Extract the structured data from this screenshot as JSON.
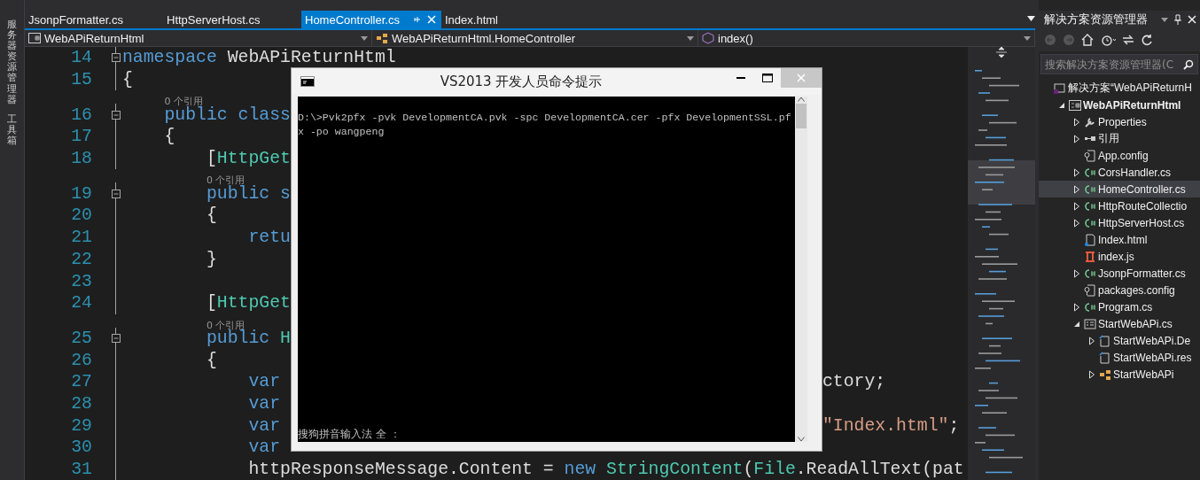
{
  "side_tabs": [
    {
      "label": "服务器资源管理器"
    },
    {
      "label": "工具箱"
    }
  ],
  "tabs": [
    {
      "label": "JsonpFormatter.cs",
      "selected": false
    },
    {
      "label": "HttpServerHost.cs",
      "selected": false
    },
    {
      "label": "HomeController.cs",
      "selected": true
    },
    {
      "label": "Index.html",
      "selected": false
    }
  ],
  "nav": [
    {
      "label": "WebAPiReturnHtml",
      "kind": "project"
    },
    {
      "label": "WebAPiReturnHtml.HomeController",
      "kind": "class"
    },
    {
      "label": "index()",
      "kind": "method"
    }
  ],
  "code_lines": [
    {
      "kind": "code",
      "number": "14",
      "fold": true,
      "tokens": [
        {
          "text": "namespace",
          "kind": "keyword"
        },
        {
          "text": " WebAPiReturnHtml",
          "kind": "plain"
        }
      ]
    },
    {
      "kind": "code",
      "number": "15",
      "fold": false,
      "tokens": [
        {
          "text": "{",
          "kind": "plain"
        }
      ]
    },
    {
      "kind": "codelens",
      "text": "    0 个引用"
    },
    {
      "kind": "code",
      "number": "16",
      "fold": true,
      "tokens": [
        {
          "text": "    public class",
          "kind": "keyword"
        }
      ]
    },
    {
      "kind": "code",
      "number": "17",
      "fold": false,
      "tokens": [
        {
          "text": "    {",
          "kind": "plain"
        }
      ]
    },
    {
      "kind": "code",
      "number": "18",
      "fold": false,
      "tokens": [
        {
          "text": "        [",
          "kind": "plain"
        },
        {
          "text": "HttpGet",
          "kind": "type"
        }
      ]
    },
    {
      "kind": "codelens",
      "text": "        0 个引用"
    },
    {
      "kind": "code",
      "number": "19",
      "fold": true,
      "tokens": [
        {
          "text": "        public s",
          "kind": "keyword"
        }
      ]
    },
    {
      "kind": "code",
      "number": "20",
      "fold": false,
      "tokens": [
        {
          "text": "        {",
          "kind": "plain"
        }
      ]
    },
    {
      "kind": "code",
      "number": "21",
      "fold": false,
      "tokens": [
        {
          "text": "            retu",
          "kind": "keyword"
        }
      ]
    },
    {
      "kind": "code",
      "number": "22",
      "fold": false,
      "tokens": [
        {
          "text": "        }",
          "kind": "plain"
        }
      ]
    },
    {
      "kind": "code",
      "number": "23",
      "fold": false
    },
    {
      "kind": "code",
      "number": "24",
      "fold": false,
      "tokens": [
        {
          "text": "        [",
          "kind": "plain"
        },
        {
          "text": "HttpGet",
          "kind": "type"
        }
      ]
    },
    {
      "kind": "codelens",
      "text": "        0 个引用"
    },
    {
      "kind": "code",
      "number": "25",
      "fold": true,
      "tokens": [
        {
          "text": "        public ",
          "kind": "keyword"
        },
        {
          "text": "H",
          "kind": "type"
        }
      ]
    },
    {
      "kind": "code",
      "number": "26",
      "fold": false,
      "tokens": [
        {
          "text": "        {",
          "kind": "plain"
        }
      ]
    },
    {
      "kind": "code",
      "number": "27",
      "fold": false,
      "tokens": [
        {
          "text": "            var",
          "kind": "keyword"
        }
      ],
      "right": [
        {
          "text": "ctory;",
          "kind": "plain"
        }
      ]
    },
    {
      "kind": "code",
      "number": "28",
      "fold": false,
      "tokens": [
        {
          "text": "            var",
          "kind": "keyword"
        }
      ]
    },
    {
      "kind": "code",
      "number": "29",
      "fold": false,
      "tokens": [
        {
          "text": "            var",
          "kind": "keyword"
        }
      ],
      "right": [
        {
          "text": "\"Index.html\"",
          "kind": "string"
        },
        {
          "text": ";",
          "kind": "plain"
        }
      ]
    },
    {
      "kind": "code",
      "number": "30",
      "fold": false,
      "tokens": [
        {
          "text": "            var",
          "kind": "keyword"
        }
      ]
    },
    {
      "kind": "code",
      "number": "31",
      "fold": false,
      "tokens": [
        {
          "text": "            httpResponseMessage.Content = ",
          "kind": "plain"
        },
        {
          "text": "new ",
          "kind": "keyword"
        },
        {
          "text": "StringContent",
          "kind": "type"
        },
        {
          "text": "(",
          "kind": "plain"
        },
        {
          "text": "File",
          "kind": "type"
        },
        {
          "text": ".ReadAllText(pat",
          "kind": "plain"
        }
      ]
    }
  ],
  "console": {
    "title": "VS2013 开发人员命令提示",
    "lines": [
      "D:\\>Pvk2pfx -pvk DevelopmentCA.pvk -spc DevelopmentCA.cer -pfx DevelopmentSSL.pf",
      "x -po wangpeng"
    ],
    "ime_status": "搜狗拼音输入法 全 ："
  },
  "explorer": {
    "title": "解决方案资源管理器",
    "search": {
      "placeholder": "搜索解决方案资源管理器(C"
    },
    "tree": [
      {
        "label": "解决方案“WebAPiReturnH",
        "kind": "solution",
        "selected": false,
        "children": [
          {
            "label": "WebAPiReturnHtml",
            "kind": "project",
            "expanded": true,
            "selected": false,
            "children": [
              {
                "label": "Properties",
                "kind": "properties",
                "expanded": false,
                "selected": false
              },
              {
                "label": "引用",
                "kind": "references",
                "expanded": false,
                "selected": false
              },
              {
                "label": "App.config",
                "kind": "config",
                "selected": false
              },
              {
                "label": "CorsHandler.cs",
                "kind": "csharp",
                "expanded": false,
                "selected": false
              },
              {
                "label": "HomeController.cs",
                "kind": "csharp",
                "expanded": false,
                "selected": true
              },
              {
                "label": "HttpRouteCollectio",
                "kind": "csharp",
                "expanded": false,
                "selected": false
              },
              {
                "label": "HttpServerHost.cs",
                "kind": "csharp",
                "expanded": false,
                "selected": false
              },
              {
                "label": "Index.html",
                "kind": "html",
                "selected": false
              },
              {
                "label": "index.js",
                "kind": "js",
                "selected": false
              },
              {
                "label": "JsonpFormatter.cs",
                "kind": "csharp",
                "expanded": false,
                "selected": false
              },
              {
                "label": "packages.config",
                "kind": "config",
                "selected": false
              },
              {
                "label": "Program.cs",
                "kind": "csharp",
                "expanded": false,
                "selected": false
              },
              {
                "label": "StartWebAPi.cs",
                "kind": "form",
                "expanded": true,
                "selected": false,
                "children": [
                  {
                    "label": "StartWebAPi.De",
                    "kind": "designer",
                    "expanded": false,
                    "selected": false
                  },
                  {
                    "label": "StartWebAPi.res",
                    "kind": "designer",
                    "selected": false
                  },
                  {
                    "label": "StartWebAPi",
                    "kind": "class",
                    "expanded": false,
                    "selected": false
                  }
                ]
              }
            ]
          }
        ]
      }
    ]
  }
}
